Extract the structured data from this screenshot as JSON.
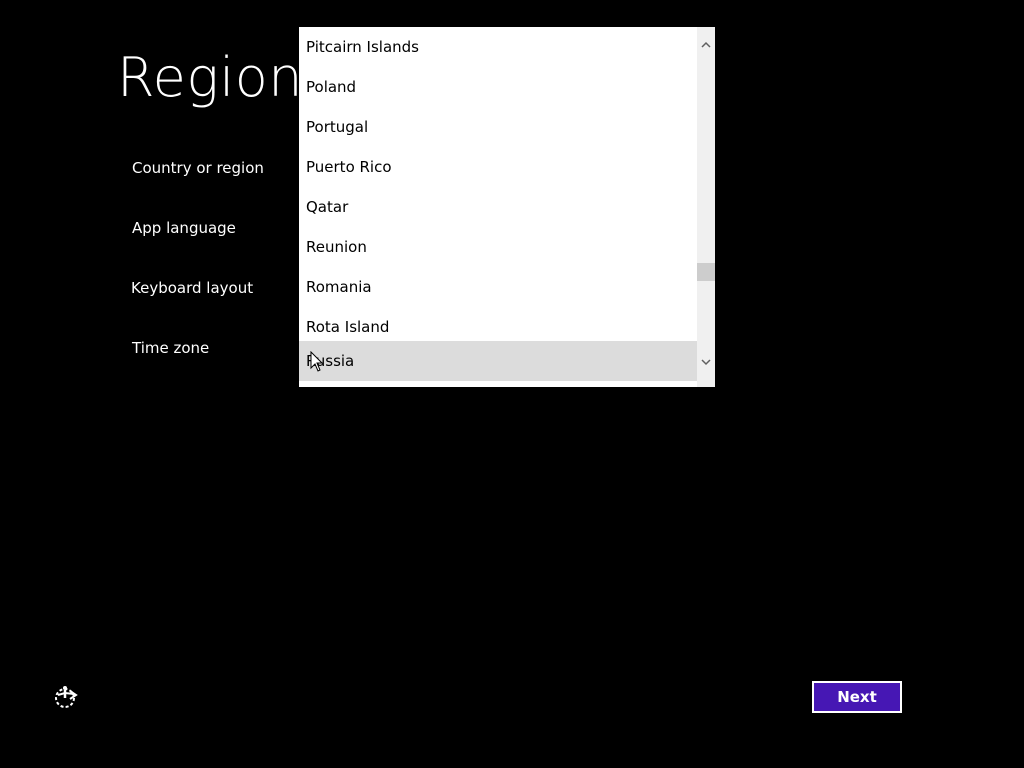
{
  "page": {
    "title": "Region",
    "background_color": "#000000",
    "accent_color": "#4617b4"
  },
  "fields": {
    "country_label": "Country or region",
    "app_language_label": "App language",
    "keyboard_layout_label": "Keyboard layout",
    "time_zone_label": "Time zone"
  },
  "country_dropdown": {
    "items": [
      "Pitcairn Islands",
      "Poland",
      "Portugal",
      "Puerto Rico",
      "Qatar",
      "Reunion",
      "Romania",
      "Rota Island",
      "Russia"
    ],
    "selected": "Russia",
    "icons": {
      "scroll_up": "chevron-up-icon",
      "scroll_down": "chevron-down-icon"
    }
  },
  "footer": {
    "ease_of_access_icon": "ease-of-access-icon",
    "next_label": "Next"
  }
}
